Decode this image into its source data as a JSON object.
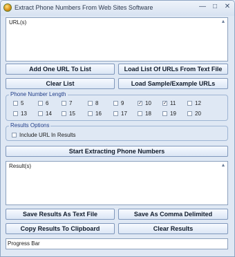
{
  "window": {
    "title": "Extract Phone Numbers From Web Sites Software"
  },
  "urls": {
    "label": "URL(s)"
  },
  "buttons": {
    "add_one_url": "Add One URL To List",
    "load_list": "Load List Of URLs From Text File",
    "clear_list": "Clear List",
    "load_sample": "Load Sample/Example URLs",
    "start": "Start Extracting Phone Numbers",
    "save_text": "Save Results As Text File",
    "save_comma": "Save As Comma Delimited",
    "copy_clipboard": "Copy Results To Clipboard",
    "clear_results": "Clear Results"
  },
  "phone_length": {
    "label": "Phone Number Length",
    "options": [
      {
        "label": "5",
        "checked": false
      },
      {
        "label": "6",
        "checked": false
      },
      {
        "label": "7",
        "checked": false
      },
      {
        "label": "8",
        "checked": false
      },
      {
        "label": "9",
        "checked": false
      },
      {
        "label": "10",
        "checked": true
      },
      {
        "label": "11",
        "checked": true
      },
      {
        "label": "12",
        "checked": false
      },
      {
        "label": "13",
        "checked": false
      },
      {
        "label": "14",
        "checked": false
      },
      {
        "label": "15",
        "checked": false
      },
      {
        "label": "16",
        "checked": false
      },
      {
        "label": "17",
        "checked": false
      },
      {
        "label": "18",
        "checked": false
      },
      {
        "label": "19",
        "checked": false
      },
      {
        "label": "20",
        "checked": false
      }
    ]
  },
  "results_options": {
    "label": "Results Options",
    "include_url_label": "Include URL In Results",
    "include_url_checked": false
  },
  "results": {
    "label": "Result(s)"
  },
  "progress": {
    "label": "Progress Bar"
  }
}
